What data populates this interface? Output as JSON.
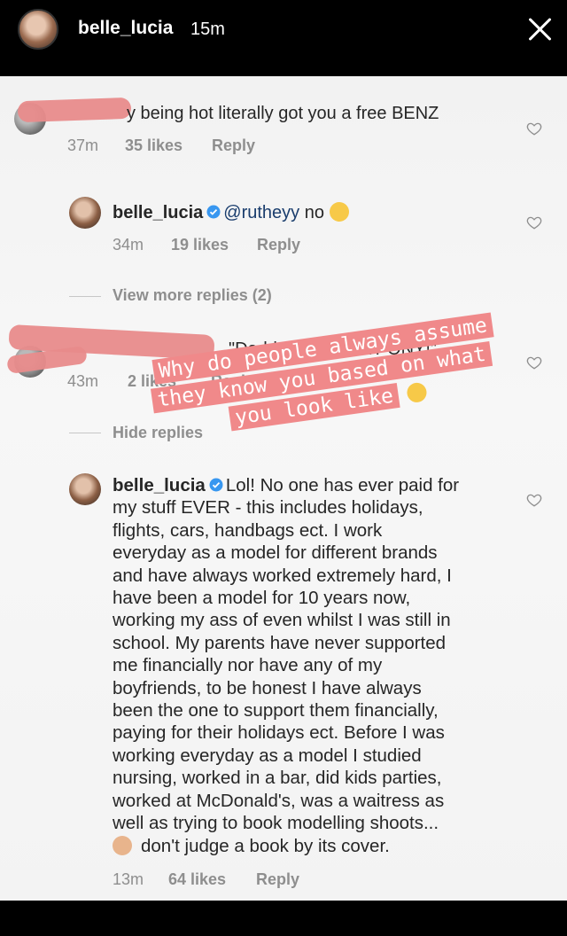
{
  "story": {
    "username": "belle_lucia",
    "time": "15m"
  },
  "comments": [
    {
      "text_suffix": "y being hot literally got you a free BENZ",
      "time": "37m",
      "likes": "35 likes",
      "reply": "Reply"
    },
    {
      "username": "belle_lucia",
      "mention": "@rutheyy",
      "text": "no",
      "time": "34m",
      "likes": "19 likes",
      "reply": "Reply"
    },
    {
      "text_suffix": "\"Daddy, I WANT A PONY!\"",
      "time": "43m",
      "likes": "2 likes",
      "reply": "Reply"
    },
    {
      "username": "belle_lucia",
      "text_lines": [
        "Lol! No one has ever paid for",
        "my stuff EVER - this includes holidays,",
        "flights, cars, handbags ect. I work",
        "everyday as a model for different brands",
        "and have always worked extremely hard, I",
        "have been a model for 10 years now,",
        "working my ass of even whilst I was still in",
        "school. My parents have never supported",
        "me financially nor have any of my",
        "boyfriends, to be honest I have always",
        "been the one to support them financially,",
        "paying for their holidays ect. Before I was",
        "working everyday as a model I studied",
        "nursing, worked in a bar, did kids parties,",
        "worked at McDonald's, was a waitress as",
        "well as trying to book modelling shoots...",
        "don't judge a book by its cover."
      ],
      "time": "13m",
      "likes": "64 likes",
      "reply": "Reply"
    }
  ],
  "view_more_replies": "View more replies (2)",
  "hide_replies": "Hide replies",
  "overlay": {
    "lines": [
      "Why do people always assume",
      "they know you based on what",
      "you look like"
    ]
  },
  "colors": {
    "overlay": "#f0898a",
    "redaction": "#e88b8b",
    "verified": "#3897f0"
  }
}
